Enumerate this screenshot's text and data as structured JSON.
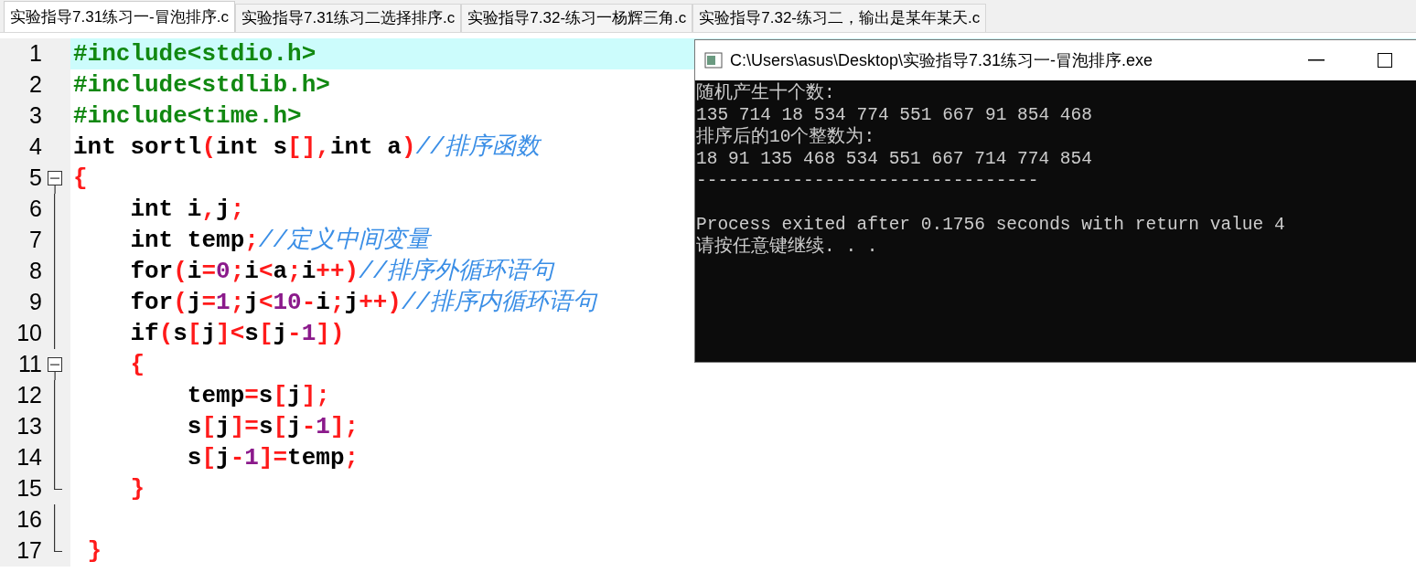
{
  "tabs": [
    {
      "label": "实验指导7.31练习一-冒泡排序.c",
      "selected": true
    },
    {
      "label": "实验指导7.31练习二选择排序.c",
      "selected": false
    },
    {
      "label": "实验指导7.32-练习一杨辉三角.c",
      "selected": false
    },
    {
      "label": "实验指导7.32-练习二，输出是某年某天.c",
      "selected": false
    }
  ],
  "editor": {
    "lines": [
      {
        "number": "1",
        "current": true,
        "fold_toggle": false,
        "fold_end": false,
        "tokens": [
          {
            "kind": "pp",
            "text": "#include<stdio.h>"
          }
        ]
      },
      {
        "number": "2",
        "current": false,
        "fold_toggle": false,
        "fold_end": false,
        "tokens": [
          {
            "kind": "pp",
            "text": "#include<stdlib.h>"
          }
        ]
      },
      {
        "number": "3",
        "current": false,
        "fold_toggle": false,
        "fold_end": false,
        "tokens": [
          {
            "kind": "pp",
            "text": "#include<time.h>"
          }
        ]
      },
      {
        "number": "4",
        "current": false,
        "fold_toggle": false,
        "fold_end": false,
        "tokens": [
          {
            "kind": "id",
            "text": "int sortl"
          },
          {
            "kind": "op",
            "text": "("
          },
          {
            "kind": "id",
            "text": "int s"
          },
          {
            "kind": "op",
            "text": "[],"
          },
          {
            "kind": "id",
            "text": "int a"
          },
          {
            "kind": "op",
            "text": ")"
          },
          {
            "kind": "cm",
            "text": "//排序函数"
          }
        ]
      },
      {
        "number": "5",
        "current": false,
        "fold_toggle": true,
        "fold_end": false,
        "tokens": [
          {
            "kind": "op",
            "text": "{"
          }
        ]
      },
      {
        "number": "6",
        "current": false,
        "fold_toggle": false,
        "fold_end": false,
        "tokens": [
          {
            "kind": "id",
            "text": "    int i"
          },
          {
            "kind": "op",
            "text": ","
          },
          {
            "kind": "id",
            "text": "j"
          },
          {
            "kind": "op",
            "text": ";"
          }
        ]
      },
      {
        "number": "7",
        "current": false,
        "fold_toggle": false,
        "fold_end": false,
        "tokens": [
          {
            "kind": "id",
            "text": "    int temp"
          },
          {
            "kind": "op",
            "text": ";"
          },
          {
            "kind": "cm",
            "text": "//定义中间变量"
          }
        ]
      },
      {
        "number": "8",
        "current": false,
        "fold_toggle": false,
        "fold_end": false,
        "tokens": [
          {
            "kind": "id",
            "text": "    for"
          },
          {
            "kind": "op",
            "text": "("
          },
          {
            "kind": "id",
            "text": "i"
          },
          {
            "kind": "op",
            "text": "="
          },
          {
            "kind": "num",
            "text": "0"
          },
          {
            "kind": "op",
            "text": ";"
          },
          {
            "kind": "id",
            "text": "i"
          },
          {
            "kind": "op",
            "text": "<"
          },
          {
            "kind": "id",
            "text": "a"
          },
          {
            "kind": "op",
            "text": ";"
          },
          {
            "kind": "id",
            "text": "i"
          },
          {
            "kind": "op",
            "text": "++)"
          },
          {
            "kind": "cm",
            "text": "//排序外循环语句"
          }
        ]
      },
      {
        "number": "9",
        "current": false,
        "fold_toggle": false,
        "fold_end": false,
        "tokens": [
          {
            "kind": "id",
            "text": "    for"
          },
          {
            "kind": "op",
            "text": "("
          },
          {
            "kind": "id",
            "text": "j"
          },
          {
            "kind": "op",
            "text": "="
          },
          {
            "kind": "num",
            "text": "1"
          },
          {
            "kind": "op",
            "text": ";"
          },
          {
            "kind": "id",
            "text": "j"
          },
          {
            "kind": "op",
            "text": "<"
          },
          {
            "kind": "num",
            "text": "10"
          },
          {
            "kind": "op",
            "text": "-"
          },
          {
            "kind": "id",
            "text": "i"
          },
          {
            "kind": "op",
            "text": ";"
          },
          {
            "kind": "id",
            "text": "j"
          },
          {
            "kind": "op",
            "text": "++)"
          },
          {
            "kind": "cm",
            "text": "//排序内循环语句"
          }
        ]
      },
      {
        "number": "10",
        "current": false,
        "fold_toggle": false,
        "fold_end": false,
        "tokens": [
          {
            "kind": "id",
            "text": "    if"
          },
          {
            "kind": "op",
            "text": "("
          },
          {
            "kind": "id",
            "text": "s"
          },
          {
            "kind": "op",
            "text": "["
          },
          {
            "kind": "id",
            "text": "j"
          },
          {
            "kind": "op",
            "text": "]<"
          },
          {
            "kind": "id",
            "text": "s"
          },
          {
            "kind": "op",
            "text": "["
          },
          {
            "kind": "id",
            "text": "j"
          },
          {
            "kind": "op",
            "text": "-"
          },
          {
            "kind": "num",
            "text": "1"
          },
          {
            "kind": "op",
            "text": "])"
          }
        ]
      },
      {
        "number": "11",
        "current": false,
        "fold_toggle": true,
        "fold_end": false,
        "tokens": [
          {
            "kind": "op",
            "text": "    {"
          }
        ]
      },
      {
        "number": "12",
        "current": false,
        "fold_toggle": false,
        "fold_end": false,
        "tokens": [
          {
            "kind": "id",
            "text": "        temp"
          },
          {
            "kind": "op",
            "text": "="
          },
          {
            "kind": "id",
            "text": "s"
          },
          {
            "kind": "op",
            "text": "["
          },
          {
            "kind": "id",
            "text": "j"
          },
          {
            "kind": "op",
            "text": "];"
          }
        ]
      },
      {
        "number": "13",
        "current": false,
        "fold_toggle": false,
        "fold_end": false,
        "tokens": [
          {
            "kind": "id",
            "text": "        s"
          },
          {
            "kind": "op",
            "text": "["
          },
          {
            "kind": "id",
            "text": "j"
          },
          {
            "kind": "op",
            "text": "]="
          },
          {
            "kind": "id",
            "text": "s"
          },
          {
            "kind": "op",
            "text": "["
          },
          {
            "kind": "id",
            "text": "j"
          },
          {
            "kind": "op",
            "text": "-"
          },
          {
            "kind": "num",
            "text": "1"
          },
          {
            "kind": "op",
            "text": "];"
          }
        ]
      },
      {
        "number": "14",
        "current": false,
        "fold_toggle": false,
        "fold_end": false,
        "tokens": [
          {
            "kind": "id",
            "text": "        s"
          },
          {
            "kind": "op",
            "text": "["
          },
          {
            "kind": "id",
            "text": "j"
          },
          {
            "kind": "op",
            "text": "-"
          },
          {
            "kind": "num",
            "text": "1"
          },
          {
            "kind": "op",
            "text": "]="
          },
          {
            "kind": "id",
            "text": "temp"
          },
          {
            "kind": "op",
            "text": ";"
          }
        ]
      },
      {
        "number": "15",
        "current": false,
        "fold_toggle": false,
        "fold_end": true,
        "tokens": [
          {
            "kind": "op",
            "text": "    }"
          }
        ]
      },
      {
        "number": "16",
        "current": false,
        "fold_toggle": false,
        "fold_end": false
      },
      {
        "number": "17",
        "current": false,
        "fold_toggle": false,
        "fold_end": true,
        "tokens": [
          {
            "kind": "op",
            "text": " }"
          }
        ]
      }
    ]
  },
  "console": {
    "title": "C:\\Users\\asus\\Desktop\\实验指导7.31练习一-冒泡排序.exe",
    "output": [
      "随机产生十个数:",
      "135 714 18 534 774 551 667 91 854 468",
      "排序后的10个整数为:",
      "18 91 135 468 534 551 667 714 774 854",
      "--------------------------------"
    ],
    "footer": [
      "Process exited after 0.1756 seconds with return value 4",
      "请按任意键继续. . ."
    ]
  }
}
